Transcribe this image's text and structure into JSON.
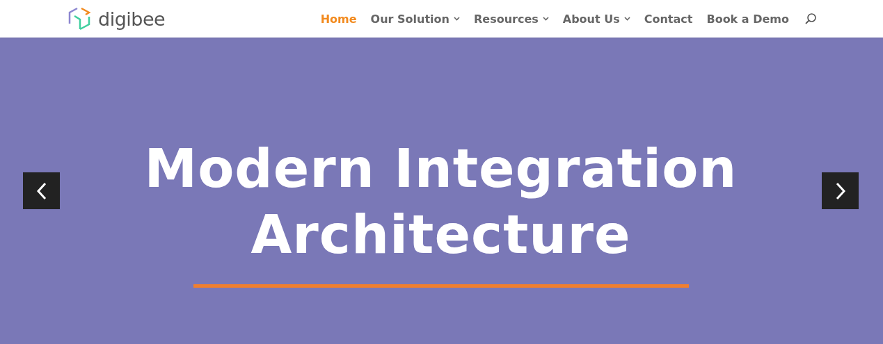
{
  "header": {
    "logo": "digibee",
    "nav": [
      {
        "label": "Home",
        "selected": true,
        "dropdown": false
      },
      {
        "label": "Our Solution",
        "selected": false,
        "dropdown": true
      },
      {
        "label": "Resources",
        "selected": false,
        "dropdown": true
      },
      {
        "label": "About Us",
        "selected": false,
        "dropdown": true
      },
      {
        "label": "Contact",
        "selected": false,
        "dropdown": false
      },
      {
        "label": "Book a Demo",
        "selected": false,
        "dropdown": false
      }
    ]
  },
  "hero": {
    "title_lines": [
      "Modern Integration",
      "Architecture"
    ]
  }
}
